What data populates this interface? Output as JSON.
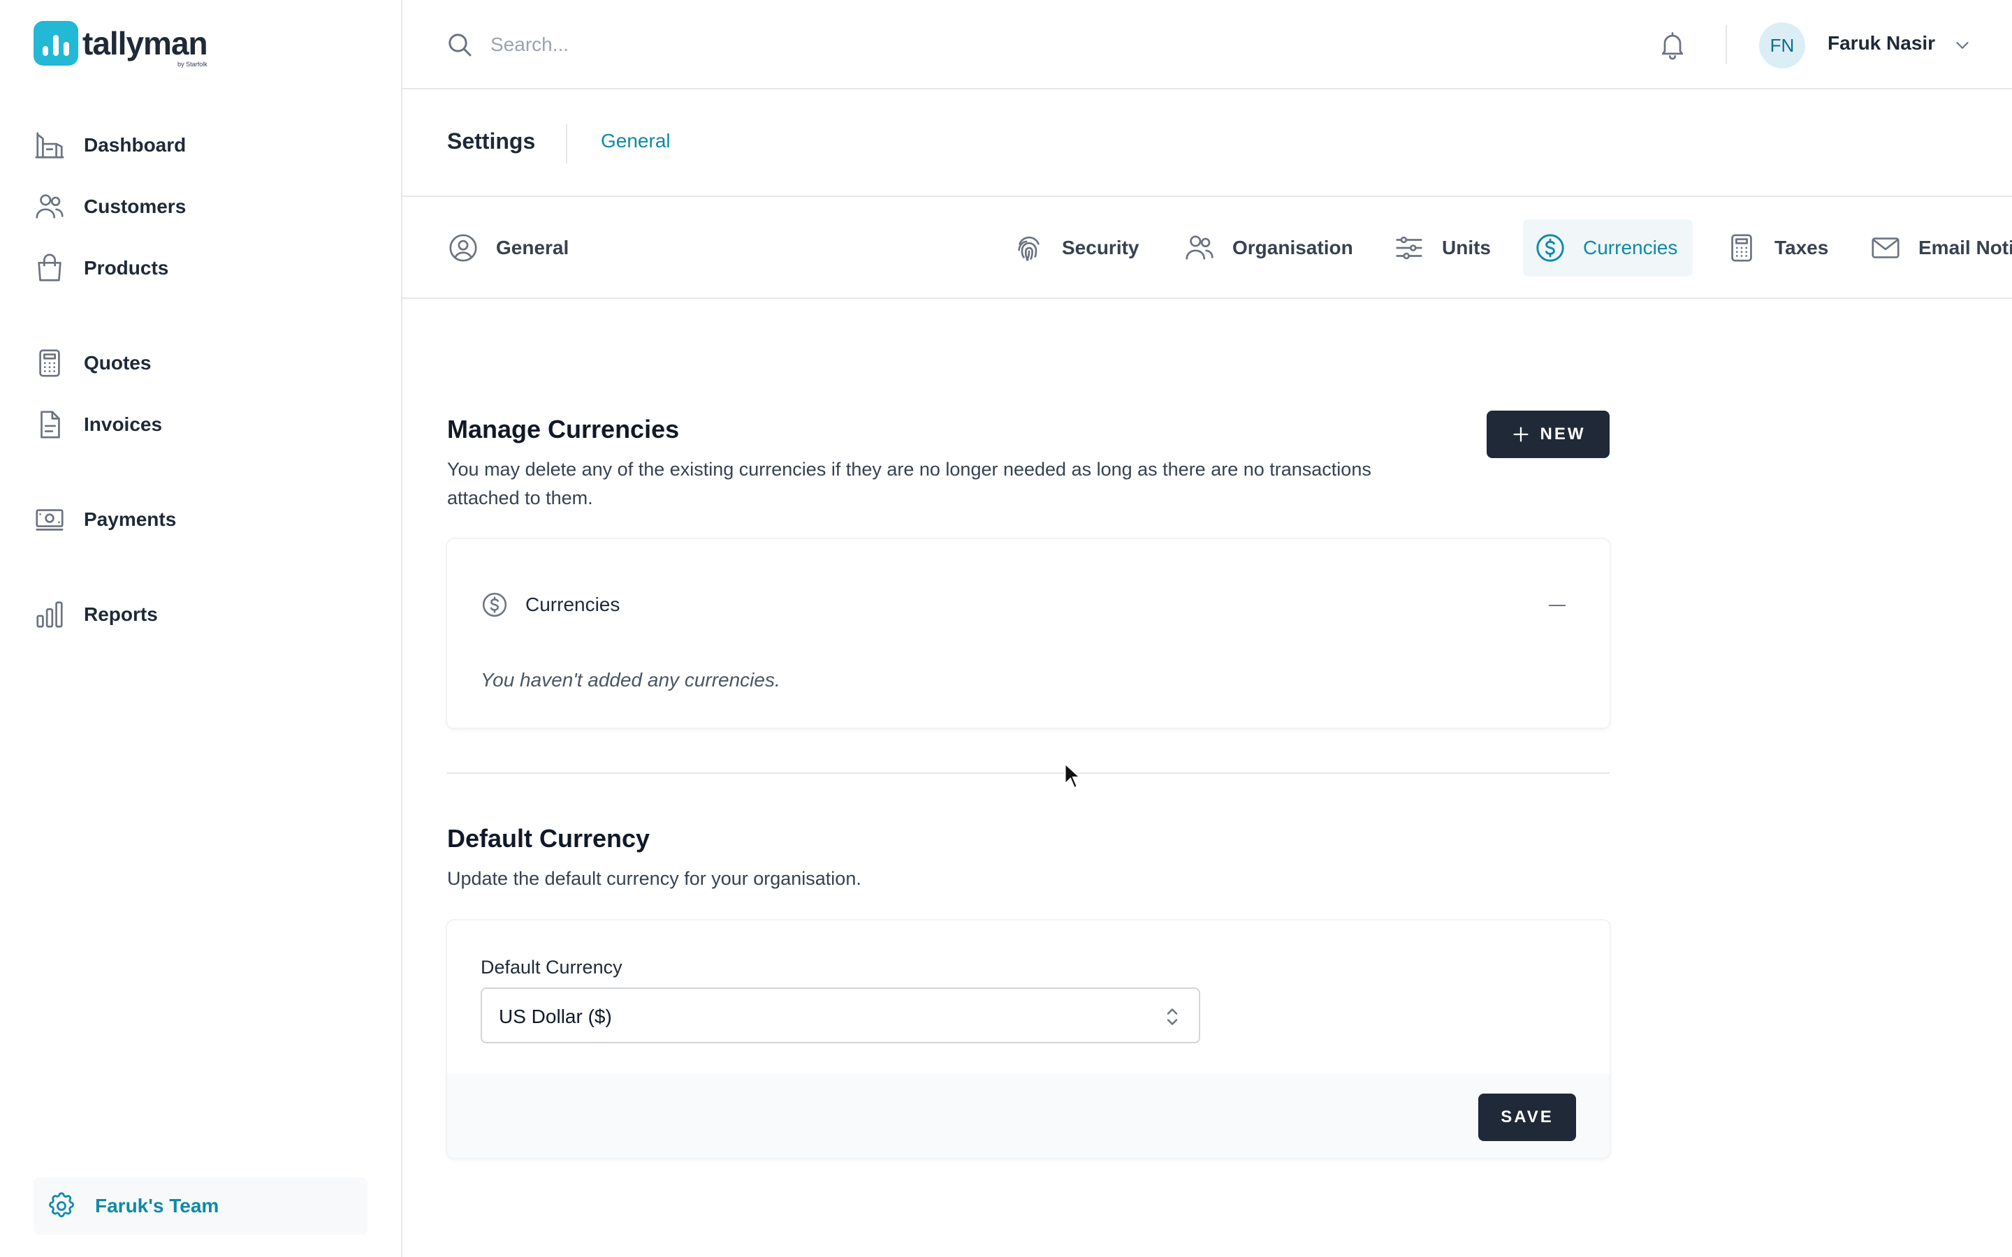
{
  "app": {
    "name": "tallyman",
    "byline": "by Starfolk",
    "brand_color": "#22b8d6",
    "accent_color": "#0e89a8"
  },
  "sidebar": {
    "items": [
      {
        "label": "Dashboard",
        "icon": "dashboard-icon"
      },
      {
        "label": "Customers",
        "icon": "users-icon"
      },
      {
        "label": "Products",
        "icon": "shopping-bag-icon"
      },
      {
        "label": "Quotes",
        "icon": "calculator-icon"
      },
      {
        "label": "Invoices",
        "icon": "document-icon"
      },
      {
        "label": "Payments",
        "icon": "cash-icon"
      },
      {
        "label": "Reports",
        "icon": "bar-chart-icon"
      }
    ],
    "team": {
      "label": "Faruk's Team",
      "icon": "gear-icon"
    }
  },
  "topbar": {
    "search_placeholder": "Search...",
    "user_initials": "FN",
    "user_name": "Faruk Nasir"
  },
  "header": {
    "title": "Settings",
    "breadcrumb": "General"
  },
  "tabs": [
    {
      "label": "General",
      "icon": "user-circle-icon",
      "active": false
    },
    {
      "label": "Security",
      "icon": "fingerprint-icon",
      "active": false
    },
    {
      "label": "Organisation",
      "icon": "users-icon",
      "active": false
    },
    {
      "label": "Units",
      "icon": "sliders-icon",
      "active": false
    },
    {
      "label": "Currencies",
      "icon": "currency-dollar-icon",
      "active": true
    },
    {
      "label": "Taxes",
      "icon": "calculator-icon",
      "active": false
    },
    {
      "label": "Email Notifications",
      "icon": "mail-icon",
      "active": false
    }
  ],
  "manage_currencies": {
    "title": "Manage Currencies",
    "description": "You may delete any of the existing currencies if they are no longer needed as long as there are no transactions attached to them.",
    "new_button": "NEW",
    "panel_title": "Currencies",
    "empty_message": "You haven't added any currencies."
  },
  "default_currency": {
    "title": "Default Currency",
    "description": "Update the default currency for your organisation.",
    "field_label": "Default Currency",
    "selected_value": "US Dollar ($)",
    "save_button": "SAVE"
  }
}
